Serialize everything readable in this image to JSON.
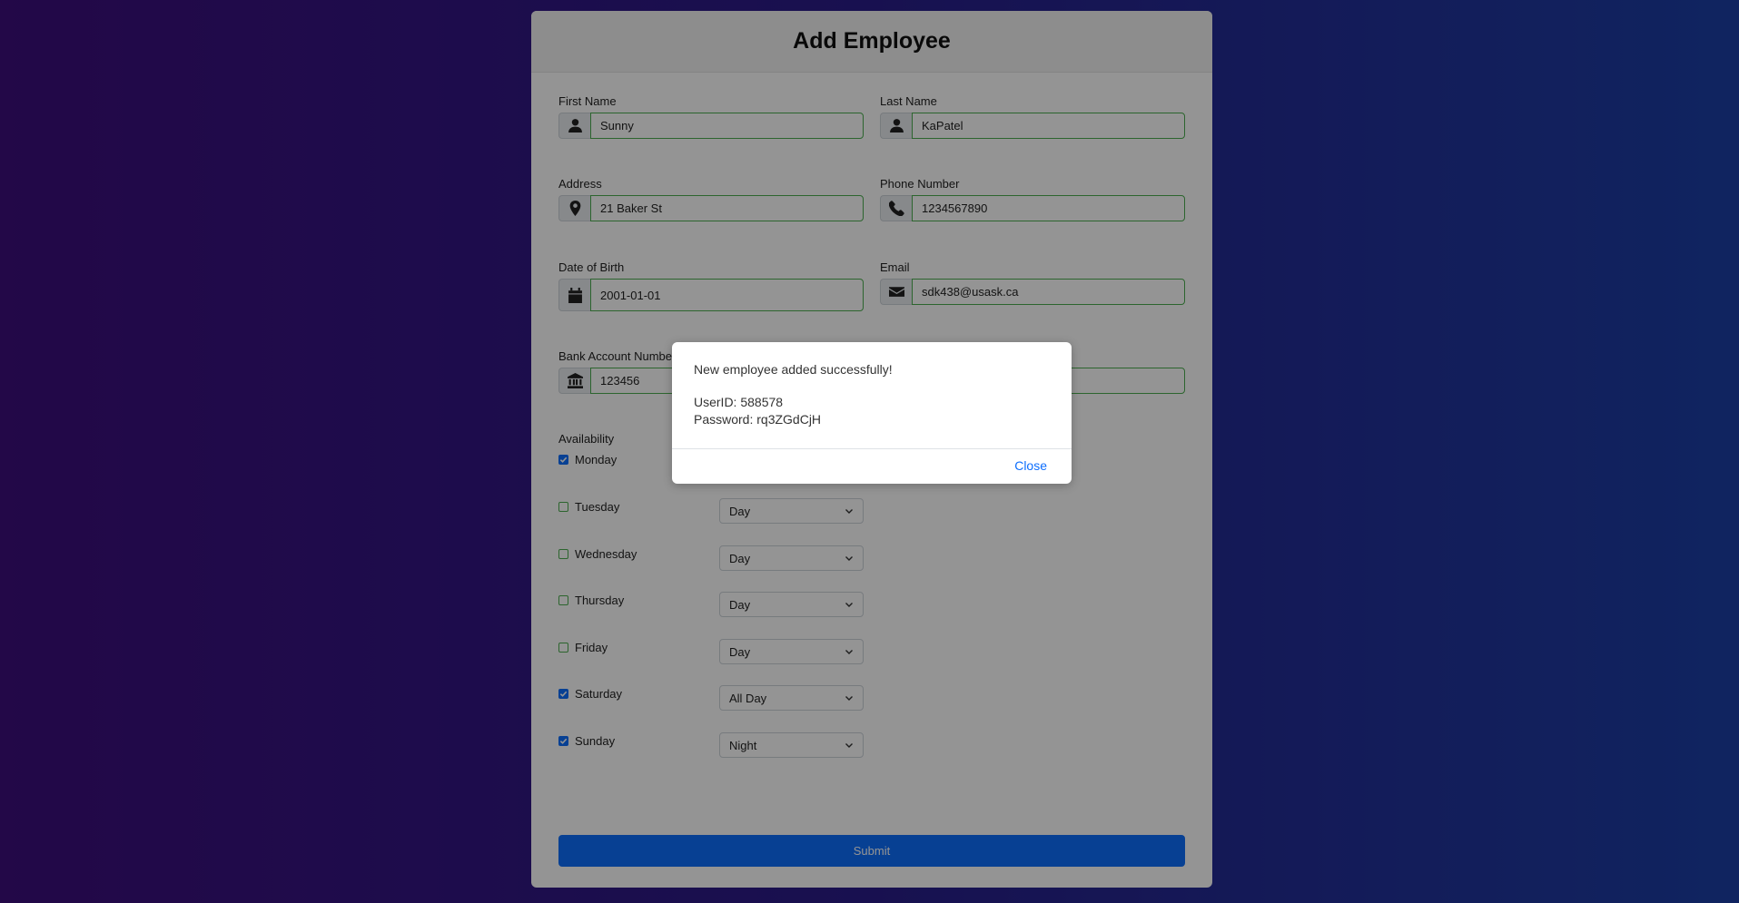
{
  "form": {
    "title": "Add Employee",
    "fields": {
      "first_name": {
        "label": "First Name",
        "value": "Sunny",
        "icon": "person-icon"
      },
      "last_name": {
        "label": "Last Name",
        "value": "KaPatel",
        "icon": "person-icon"
      },
      "address": {
        "label": "Address",
        "value": "21 Baker St",
        "icon": "location-pin-icon"
      },
      "phone": {
        "label": "Phone Number",
        "value": "1234567890",
        "icon": "phone-icon"
      },
      "dob": {
        "label": "Date of Birth",
        "value": "2001-01-01",
        "icon": "calendar-icon"
      },
      "email": {
        "label": "Email",
        "value": "sdk438@usask.ca",
        "icon": "envelope-icon"
      },
      "bank": {
        "label": "Bank Account Number",
        "value": "123456",
        "icon": "bank-icon"
      }
    },
    "availability": {
      "label": "Availability",
      "days": [
        {
          "name": "Monday",
          "checked": true,
          "shift": ""
        },
        {
          "name": "Tuesday",
          "checked": false,
          "shift": "Day"
        },
        {
          "name": "Wednesday",
          "checked": false,
          "shift": "Day"
        },
        {
          "name": "Thursday",
          "checked": false,
          "shift": "Day"
        },
        {
          "name": "Friday",
          "checked": false,
          "shift": "Day"
        },
        {
          "name": "Saturday",
          "checked": true,
          "shift": "All Day"
        },
        {
          "name": "Sunday",
          "checked": true,
          "shift": "Night"
        }
      ]
    },
    "submit_label": "Submit"
  },
  "modal": {
    "message": "New employee added successfully!",
    "userid_line": "UserID: 588578",
    "password_line": "Password: rq3ZGdCjH",
    "close_label": "Close"
  },
  "colors": {
    "accent": "#0d6efd",
    "valid_border": "#4caf50",
    "bg_gradient_start": "#3d0e7c",
    "bg_gradient_end": "#1c3fa6"
  }
}
